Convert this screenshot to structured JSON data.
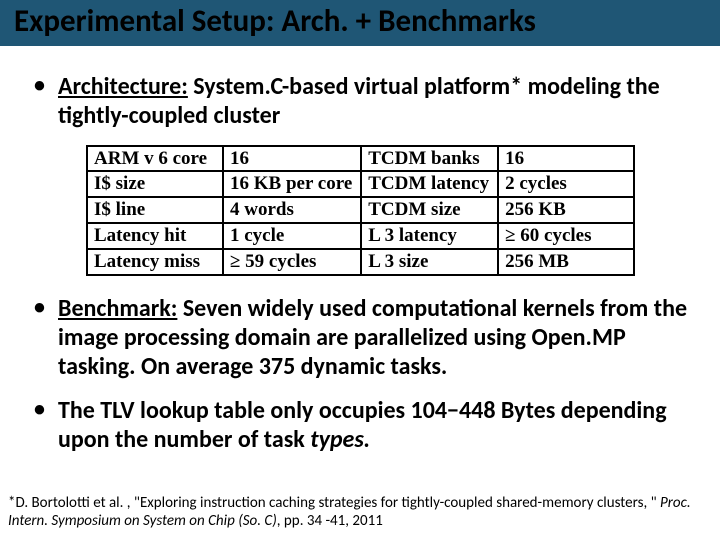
{
  "title": "Experimental Setup: Arch. + Benchmarks",
  "bullet1": {
    "label": "Architecture:",
    "text": " System.C-based virtual platform* modeling the tightly-coupled cluster"
  },
  "table": {
    "left": [
      {
        "k": "ARM v 6 core",
        "v": "16"
      },
      {
        "k": "I$ size",
        "v": "16 KB per core"
      },
      {
        "k": "I$ line",
        "v": "4 words"
      },
      {
        "k": "Latency hit",
        "v": "1 cycle"
      },
      {
        "k": "Latency miss",
        "v": "≥ 59 cycles"
      }
    ],
    "right": [
      {
        "k": "TCDM banks",
        "v": "16"
      },
      {
        "k": "TCDM latency",
        "v": "2 cycles"
      },
      {
        "k": "TCDM size",
        "v": "256 KB"
      },
      {
        "k": "L 3 latency",
        "v": "≥ 60 cycles"
      },
      {
        "k": "L 3 size",
        "v": "256 MB"
      }
    ]
  },
  "bullet2": {
    "label": "Benchmark:",
    "text": " Seven widely used computational kernels from the image processing domain are parallelized using Open.MP tasking. On average 375 dynamic tasks."
  },
  "bullet3": {
    "pre": "The TLV lookup table only occupies 104−448 Bytes depending upon the number of task ",
    "em": "types.",
    "post": ""
  },
  "footnote": {
    "pre": "*D. Bortolotti et al. , \"Exploring instruction caching strategies for tightly-coupled shared-memory clusters, \" ",
    "em": "Proc. Intern. Symposium on System on Chip (So. C)",
    "post": ", pp. 34 -41, 2011"
  }
}
